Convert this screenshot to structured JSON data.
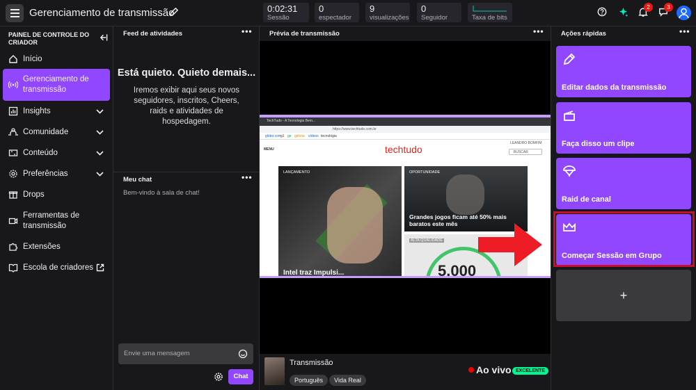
{
  "header": {
    "title": "Gerenciamento de transmissão"
  },
  "stats": [
    {
      "value": "0:02:31",
      "label": "Sessão"
    },
    {
      "value": "0",
      "label": "espectador"
    },
    {
      "value": "9",
      "label": "visualizações"
    },
    {
      "value": "0",
      "label": "Seguidor"
    },
    {
      "value": "",
      "label": "Taxa de bits"
    }
  ],
  "badges": {
    "notifications": "2",
    "whispers": "3"
  },
  "sidebar": {
    "heading": "PAINEL DE CONTROLE DO CRIADOR",
    "items": [
      {
        "label": "Início"
      },
      {
        "label": "Gerenciamento de transmissão"
      },
      {
        "label": "Insights"
      },
      {
        "label": "Comunidade"
      },
      {
        "label": "Conteúdo"
      },
      {
        "label": "Preferências"
      },
      {
        "label": "Drops"
      },
      {
        "label": "Ferramentas de transmissão"
      },
      {
        "label": "Extensões"
      },
      {
        "label": "Escola de criadores"
      }
    ]
  },
  "activity": {
    "title": "Feed de atividades",
    "empty_title": "Está quieto. Quieto demais...",
    "empty_body": "Iremos exibir aqui seus novos seguidores, inscritos, Cheers, raids e atividades de hospedagem."
  },
  "chat": {
    "title": "Meu chat",
    "welcome": "Bem-vindo à sala de chat!",
    "placeholder": "Envie uma mensagem",
    "send_label": "Chat"
  },
  "preview": {
    "title": "Prévia de transmissão",
    "site_logo": "techtudo",
    "nav_links": [
      "globo.com",
      "g1",
      "ge",
      "gshow",
      "vídeos",
      "tecnologia"
    ],
    "menu_label": "MENU",
    "search_label": "BUSCAR",
    "user_label": "LEANDRO BOMFIM",
    "url": "https://www.techtudo.com.br",
    "tab_title": "TechTudo - A Tecnologia Bem...",
    "card1_tag": "LANÇAMENTO",
    "card1_title": "Intel traz Impulsi...",
    "card2_tag": "OPORTUNIDADE",
    "card2_title": "Grandes jogos ficam até 50% mais baratos este mês",
    "card3_tag": "ALTA QUALIDADE",
    "card3_value": "5.000"
  },
  "stream": {
    "title": "Transmissão",
    "tags": [
      "Português",
      "Vida Real"
    ],
    "live_label": "Ao vivo",
    "quality": "EXCELENTE"
  },
  "quick_actions": {
    "title": "Ações rápidas",
    "items": [
      {
        "label": "Editar dados da transmissão",
        "icon": "pencil-icon"
      },
      {
        "label": "Faça disso um clipe",
        "icon": "clapperboard-icon"
      },
      {
        "label": "Raid de canal",
        "icon": "parachute-icon"
      },
      {
        "label": "Começar Sessão em Grupo",
        "icon": "crown-icon"
      }
    ],
    "add_label": "+"
  },
  "colors": {
    "accent": "#9147ff",
    "live": "#eb0400",
    "quality": "#00f593",
    "highlight": "#c8102e"
  }
}
